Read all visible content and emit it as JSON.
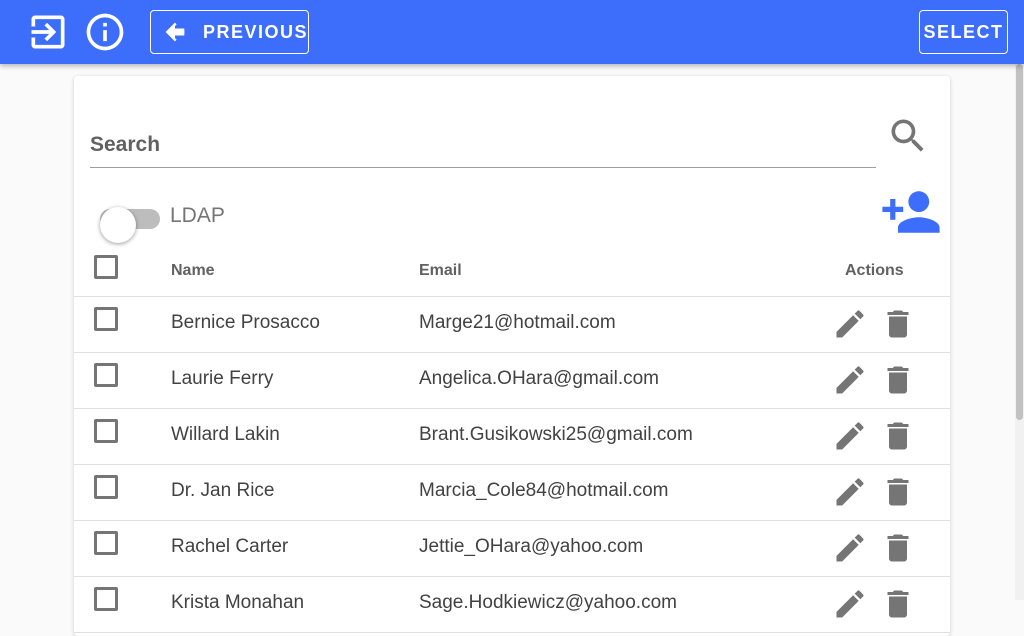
{
  "toolbar": {
    "previous_label": "PREVIOUS",
    "select_label": "SELECT",
    "icons": [
      "login-icon",
      "info-icon",
      "arrow-back-icon"
    ],
    "background": "#3d6dfb"
  },
  "search": {
    "placeholder": "Search",
    "value": ""
  },
  "filters": {
    "ldap_label": "LDAP",
    "ldap_enabled": false
  },
  "table": {
    "columns": [
      "Name",
      "Email",
      "Actions"
    ],
    "rows": [
      {
        "name": "Bernice Prosacco",
        "email": "Marge21@hotmail.com"
      },
      {
        "name": "Laurie Ferry",
        "email": "Angelica.OHara@gmail.com"
      },
      {
        "name": "Willard Lakin",
        "email": "Brant.Gusikowski25@gmail.com"
      },
      {
        "name": "Dr. Jan Rice",
        "email": "Marcia_Cole84@hotmail.com"
      },
      {
        "name": "Rachel Carter",
        "email": "Jettie_OHara@yahoo.com"
      },
      {
        "name": "Krista Monahan",
        "email": "Sage.Hodkiewicz@yahoo.com"
      }
    ]
  },
  "colors": {
    "accent": "#3d6dfb",
    "icon_gray": "#757575"
  }
}
